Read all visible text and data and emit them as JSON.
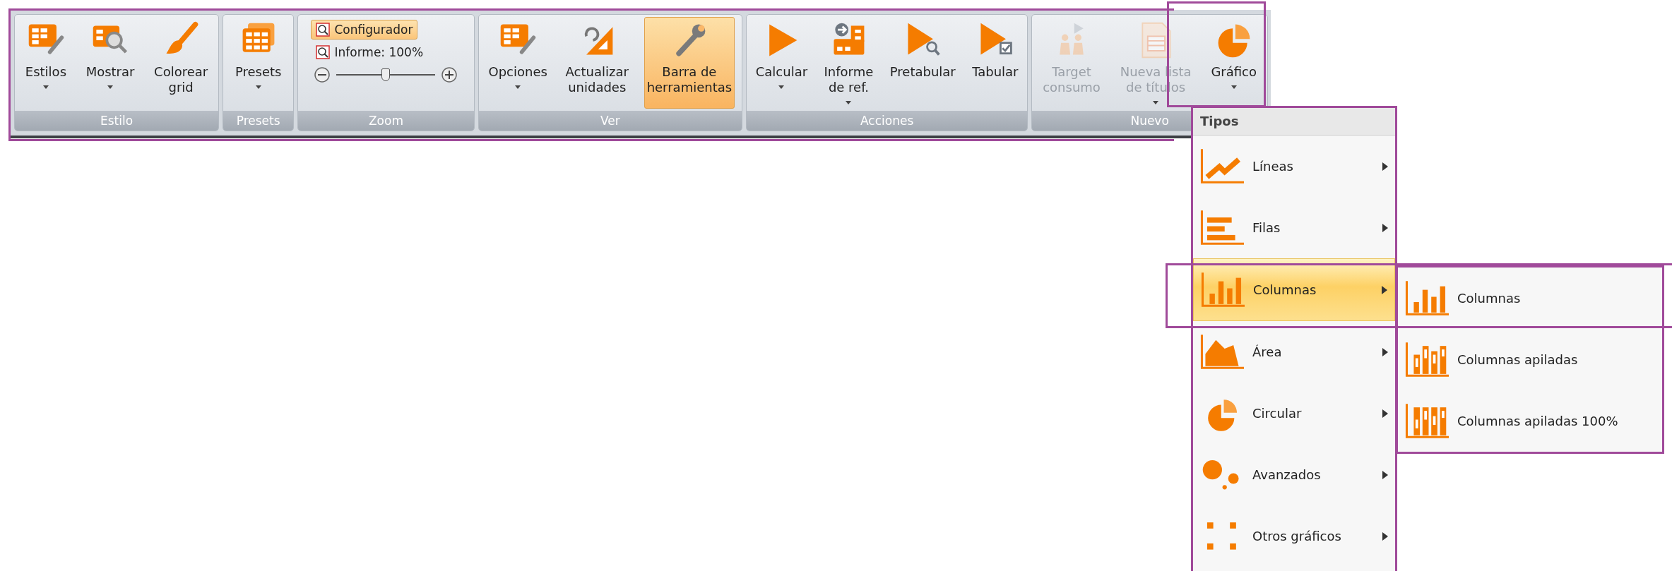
{
  "ribbon": {
    "groups": [
      {
        "label": "Estilo",
        "kind": "buttons",
        "items": [
          {
            "label": "Estilos",
            "dropdown": true,
            "pressed": false,
            "disabled": false
          },
          {
            "label": "Mostrar",
            "dropdown": true,
            "pressed": false,
            "disabled": false
          },
          {
            "label": "Colorear\ngrid",
            "dropdown": false,
            "pressed": false,
            "disabled": false
          }
        ]
      },
      {
        "label": "Presets",
        "kind": "buttons",
        "items": [
          {
            "label": "Presets",
            "dropdown": true,
            "pressed": false,
            "disabled": false
          }
        ]
      },
      {
        "label": "Zoom",
        "kind": "zoom",
        "toggles": [
          {
            "label": "Configurador",
            "selected": true
          },
          {
            "label": "Informe: 100%",
            "selected": false
          }
        ],
        "slider": {
          "level": 0.5
        }
      },
      {
        "label": "Ver",
        "kind": "buttons",
        "items": [
          {
            "label": "Opciones",
            "dropdown": true,
            "pressed": false,
            "disabled": false
          },
          {
            "label": "Actualizar\nunidades",
            "dropdown": false,
            "pressed": false,
            "disabled": false
          },
          {
            "label": "Barra de\nherramientas",
            "dropdown": false,
            "pressed": true,
            "disabled": false
          }
        ]
      },
      {
        "label": "Acciones",
        "kind": "buttons",
        "items": [
          {
            "label": "Calcular",
            "dropdown": true,
            "pressed": false,
            "disabled": false
          },
          {
            "label": "Informe\nde ref.",
            "dropdown": true,
            "pressed": false,
            "disabled": false
          },
          {
            "label": "Pretabular",
            "dropdown": false,
            "pressed": false,
            "disabled": false
          },
          {
            "label": "Tabular",
            "dropdown": false,
            "pressed": false,
            "disabled": false
          }
        ]
      },
      {
        "label": "Nuevo",
        "kind": "buttons",
        "items": [
          {
            "label": "Target\nconsumo",
            "dropdown": false,
            "pressed": false,
            "disabled": true
          },
          {
            "label": "Nueva lista\nde títulos",
            "dropdown": true,
            "pressed": false,
            "disabled": true
          },
          {
            "label": "Gráfico",
            "dropdown": true,
            "pressed": false,
            "disabled": false
          }
        ]
      }
    ]
  },
  "menu": {
    "header": "Tipos",
    "items": [
      {
        "label": "Líneas",
        "selected": false
      },
      {
        "label": "Filas",
        "selected": false
      },
      {
        "label": "Columnas",
        "selected": true
      },
      {
        "label": "Área",
        "selected": false
      },
      {
        "label": "Circular",
        "selected": false
      },
      {
        "label": "Avanzados",
        "selected": false
      },
      {
        "label": "Otros gráficos",
        "selected": false
      }
    ],
    "submenu": {
      "items": [
        {
          "label": "Columnas"
        },
        {
          "label": "Columnas apiladas"
        },
        {
          "label": "Columnas apiladas 100%"
        }
      ]
    }
  }
}
